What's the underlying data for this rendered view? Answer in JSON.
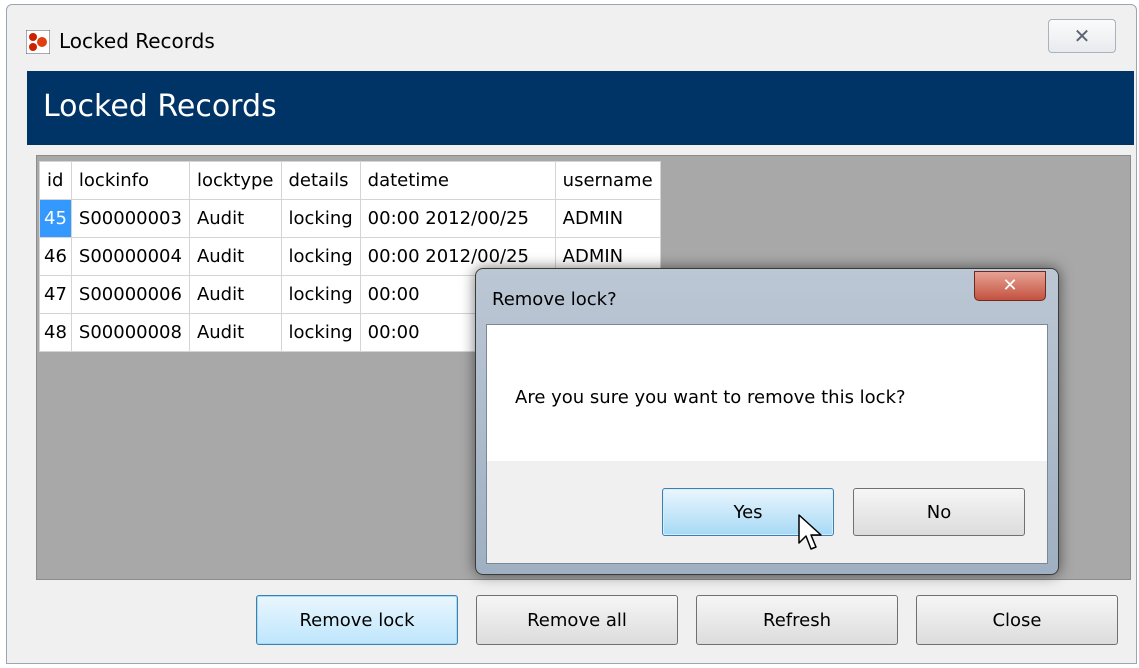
{
  "window": {
    "title": "Locked Records",
    "close_glyph": "✕"
  },
  "header": {
    "title": "Locked Records"
  },
  "table": {
    "columns": [
      "id",
      "lockinfo",
      "locktype",
      "details",
      "datetime",
      "username"
    ],
    "rows": [
      [
        "45",
        "S00000003",
        "Audit",
        "locking",
        "00:00 2012/00/25",
        "ADMIN"
      ],
      [
        "46",
        "S00000004",
        "Audit",
        "locking",
        "00:00 2012/00/25",
        "ADMIN"
      ],
      [
        "47",
        "S00000006",
        "Audit",
        "locking",
        "00:00",
        ""
      ],
      [
        "48",
        "S00000008",
        "Audit",
        "locking",
        "00:00",
        ""
      ]
    ],
    "selected_cell": "45"
  },
  "buttons": {
    "remove_lock": "Remove lock",
    "remove_all": "Remove all",
    "refresh": "Refresh",
    "close": "Close"
  },
  "dialog": {
    "title": "Remove lock?",
    "close_glyph": "✕",
    "message": "Are you sure you want to remove this lock?",
    "yes": "Yes",
    "no": "No"
  },
  "colors": {
    "header_band": "#003366",
    "selection": "#3399ff",
    "grid_background": "#a8a8a8"
  },
  "icons": [
    "app-icon",
    "window-close-icon",
    "dialog-close-icon",
    "mouse-cursor-icon"
  ]
}
